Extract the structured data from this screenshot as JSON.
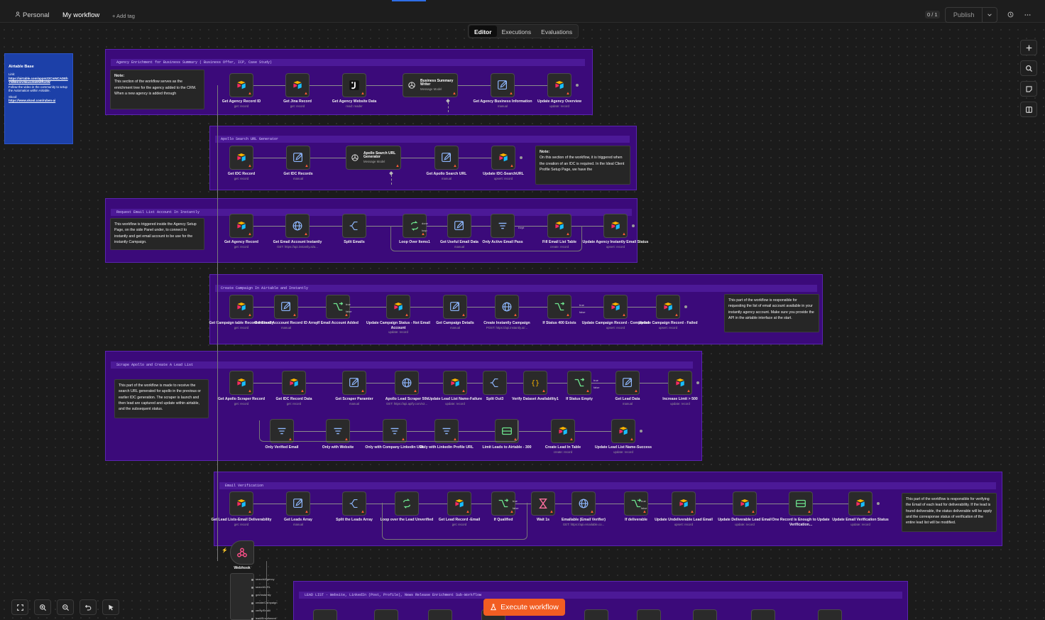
{
  "topbar": {
    "personal": "Personal",
    "workflow": "My workflow",
    "add_tag": "+ Add tag",
    "counter": "0 / 1",
    "publish": "Publish"
  },
  "tabs": [
    "Editor",
    "Executions",
    "Evaluations"
  ],
  "execute": "Execute workflow",
  "airtable_note": {
    "title": "Airtable Base",
    "link_label": "Link:",
    "link": "https://airtable.com/appm22CmNCADEhYWBH/shr5kwzz5kNWRo0W",
    "text": "Follow the video in the community to setup the Automation within Airtable.",
    "skool_label": "Skool:",
    "skool": "https://www.skool.com/ruben-ai"
  },
  "sections": [
    {
      "title": "Agency Enrichment for Business Summary ( Business Offer, ICP, Case Study)",
      "note": {
        "title": "Note:",
        "text": "This section of the workflow serves as the enrichment tree for the agency added to the CRM. When a new agency is added through"
      },
      "nodes": [
        {
          "label": "Get Agency Record ID",
          "sub": "get: record"
        },
        {
          "label": "Get Jina Record",
          "sub": "get: record"
        },
        {
          "label": "Get Agency Website Data",
          "sub": "read: reader"
        },
        {
          "label": "Business Summary Writer",
          "sub": "Message Model"
        },
        {
          "label": "Get Agency Business Information",
          "sub": "manual"
        },
        {
          "label": "Update Agency Overview",
          "sub": "update: record"
        }
      ]
    },
    {
      "title": "Apollo Search URL Generator",
      "note": {
        "title": "Note:",
        "text": "On this section of the workflow, it is triggered when the creation of an IDC is required. In the Ideal Client Profile Setup Page, we have the"
      },
      "nodes": [
        {
          "label": "Get IDC Record",
          "sub": "get: record"
        },
        {
          "label": "Get IDC Records",
          "sub": "manual"
        },
        {
          "label": "Apollo Search URL Generator",
          "sub": "Message Model"
        },
        {
          "label": "Get Apollo Search URL",
          "sub": "manual"
        },
        {
          "label": "Update IDC-SearchURL",
          "sub": "upsert: record"
        }
      ]
    },
    {
      "title": "Request Email List Account In Instantly",
      "note": {
        "title": "",
        "text": "This workflow is triggered inside the Agency Setup Page, on the side Panel under, to connect to instantly and get email account to be use for the instantly Campaign."
      },
      "nodes": [
        {
          "label": "Get Agency Record",
          "sub": "get: record"
        },
        {
          "label": "Get Email Account Instantly",
          "sub": "GET: https://api.instantly.ai/a..."
        },
        {
          "label": "Split Emails",
          "sub": ""
        },
        {
          "label": "Loop Over Items1",
          "sub": ""
        },
        {
          "label": "Get Useful Email Data",
          "sub": "manual"
        },
        {
          "label": "Only Active Email Pass",
          "sub": ""
        },
        {
          "label": "Fill Email List Table",
          "sub": "create: record"
        },
        {
          "label": "Update Agency Instantly Email Status",
          "sub": "upsert: record"
        }
      ]
    },
    {
      "title": "Create Campaign In Airtable and Instantly",
      "note": {
        "title": "",
        "text": "This part of the workflow is responsible for requesting the list of email account available in your instantly agency account. Make sure you provide the API in the airtable interface at the start."
      },
      "nodes": [
        {
          "label": "Get Campaign table Record-Instantly",
          "sub": "get: record"
        },
        {
          "label": "Get Email Acccount Record ID Array",
          "sub": "manual"
        },
        {
          "label": "If Email Account Added",
          "sub": ""
        },
        {
          "label": "Update Campaign Status - Not Email Account",
          "sub": "update: record"
        },
        {
          "label": "Get Campaign Details",
          "sub": "manual"
        },
        {
          "label": "Create Instantly Campaign",
          "sub": "POST: https://api.instantly.ai/..."
        },
        {
          "label": "If Status 400 Exists",
          "sub": ""
        },
        {
          "label": "Update Campaign Record - Completed",
          "sub": "upsert: record"
        },
        {
          "label": "Update Campaign Record - Failed",
          "sub": "upsert: record"
        }
      ]
    },
    {
      "title": "Scrape Apollo and Create A Lead List",
      "note": {
        "title": "",
        "text": "This part of the workflow is made to receive the search URL generated for apollo in the previous or earlier IDC generation. The scraper is launch and then lead are captured and update within airtable, and the subsequent status."
      },
      "nodes": [
        {
          "label": "Get Apollo Scraper Record",
          "sub": "get: record"
        },
        {
          "label": "Get IDC Record Data",
          "sub": "get: record"
        },
        {
          "label": "Get Scraper Paramter",
          "sub": "manual"
        },
        {
          "label": "Apollo Lead Scraper 50k",
          "sub": "GET: https://api.apify.com/v2..."
        },
        {
          "label": "Update Lead List Name-Failure",
          "sub": "update: record"
        },
        {
          "label": "Split Out3",
          "sub": ""
        },
        {
          "label": "Verify Dataset Availability1",
          "sub": ""
        },
        {
          "label": "If Status Empty",
          "sub": ""
        },
        {
          "label": "Get Lead Data",
          "sub": "manual"
        },
        {
          "label": "Increase Limit > 500",
          "sub": "update: record"
        },
        {
          "label": "Only Verified Email",
          "sub": ""
        },
        {
          "label": "Only with Website",
          "sub": ""
        },
        {
          "label": "Only with Company Linkedin URL",
          "sub": ""
        },
        {
          "label": "Only with Linkedin Profile URL",
          "sub": ""
        },
        {
          "label": "Limit Leads to Airtable - 300",
          "sub": ""
        },
        {
          "label": "Create Lead In Table",
          "sub": "create: record"
        },
        {
          "label": "Update Lead List Name-Success",
          "sub": "update: record"
        }
      ]
    },
    {
      "title": "Email Verification",
      "note": {
        "title": "",
        "text": "This part of the workflow is responsible for verifying the Email of each lead for deliverability. If the lead is found deliverable, the status deliverable will be apply and the corresponse status of verification of the entire lead list will be modified."
      },
      "nodes": [
        {
          "label": "Get Lead Lists-Email Deliverability",
          "sub": "get: record"
        },
        {
          "label": "Get Leads Array",
          "sub": "manual"
        },
        {
          "label": "Split the Leads Array",
          "sub": ""
        },
        {
          "label": "Loop over the Lead Unverified",
          "sub": ""
        },
        {
          "label": "Get Lead Record -Email",
          "sub": "get: record"
        },
        {
          "label": "If Qualified",
          "sub": ""
        },
        {
          "label": "Wait 1s",
          "sub": ""
        },
        {
          "label": "Emailable (Email Verifier)",
          "sub": "GET: https://api.emailable.co..."
        },
        {
          "label": "If deliverable",
          "sub": ""
        },
        {
          "label": "Update Undeliverable Lead Email",
          "sub": "upsert: record"
        },
        {
          "label": "Update Deliverable Lead Email",
          "sub": "update: record"
        },
        {
          "label": "One Record is Enough to Update Verification...",
          "sub": ""
        },
        {
          "label": "Update Email Verification Status",
          "sub": "update: record"
        }
      ]
    },
    {
      "title": "LEAD LIST - Website, LinkedIn (Post, Profile), News Release Enrichment Sub-Workflow"
    }
  ],
  "webhook": {
    "label": "Webhook"
  },
  "webhook_outputs": [
    "search/Agency",
    "search/URL",
    "get/Instantly",
    "create/Campaign",
    "verify/Email",
    "lead/Enrichment"
  ],
  "branch_labels": {
    "true": "true",
    "false": "false",
    "done": "done",
    "loop": "loop",
    "kept": "Kept"
  },
  "colors": {
    "section": "#3b0a7a",
    "section_border": "#5a24b0",
    "airtable_note": "#1c40a8",
    "execute": "#f25d22",
    "airtable_yellow": "#fcb400",
    "airtable_red": "#f82b60",
    "airtable_blue": "#18bfff",
    "warning": "#ff5a36"
  },
  "icons": [
    "user-icon",
    "history-icon",
    "more-icon",
    "plus-icon",
    "search-icon",
    "sticky-note-icon",
    "panel-icon",
    "fit-view-icon",
    "zoom-in-icon",
    "zoom-out-icon",
    "undo-icon",
    "pointer-icon",
    "flask-icon"
  ]
}
